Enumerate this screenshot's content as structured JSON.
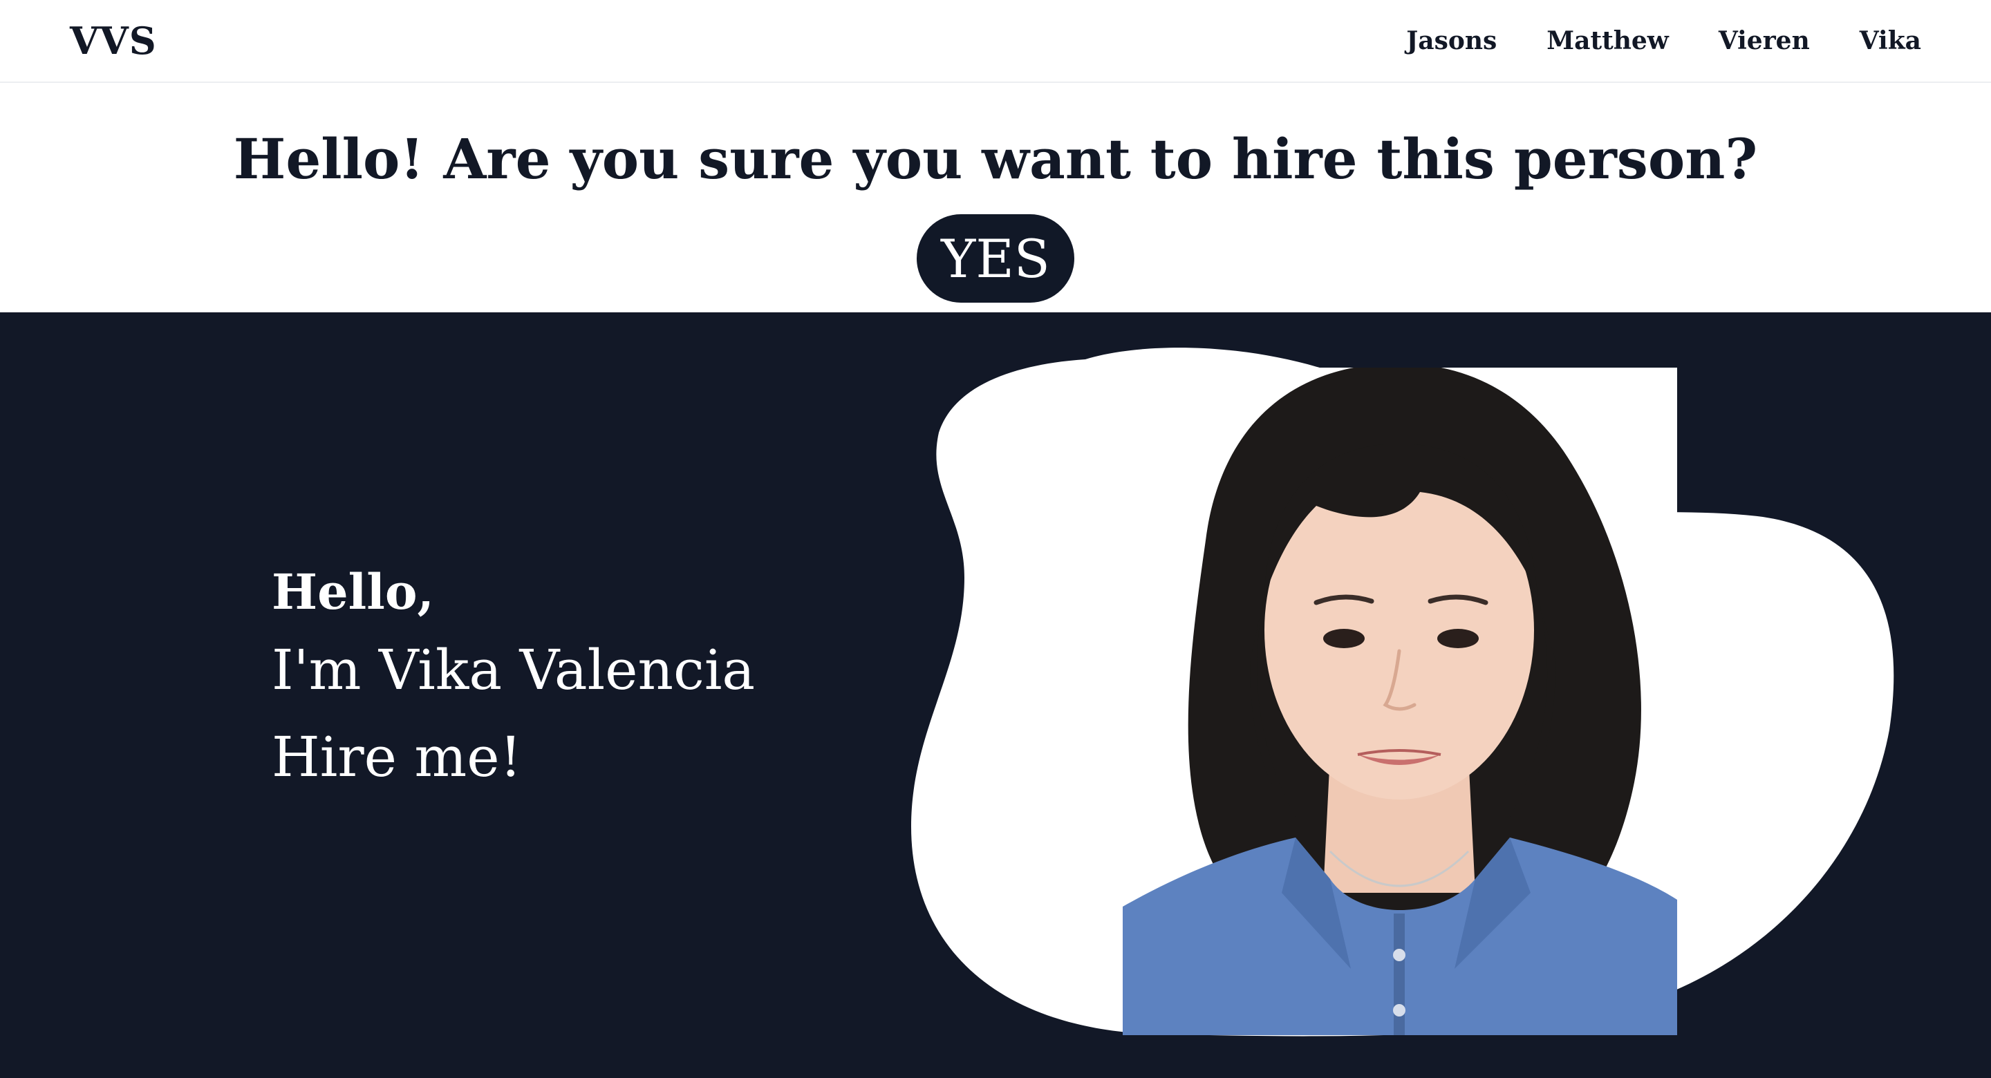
{
  "navbar": {
    "brand": "VVS",
    "links": [
      {
        "label": "Jasons"
      },
      {
        "label": "Matthew"
      },
      {
        "label": "Vieren"
      },
      {
        "label": "Vika"
      }
    ]
  },
  "confirm": {
    "question": "Hello! Are you sure you want to hire this person?",
    "yes_label": "YES"
  },
  "hero": {
    "greeting": "Hello,",
    "name_line": "I'm Vika Valencia",
    "cta_line": "Hire me!"
  },
  "colors": {
    "navy": "#121827",
    "text_dark": "#121826",
    "white": "#ffffff",
    "shirt_blue": "#5d82c0"
  },
  "icons": {
    "portrait": "profile-photo"
  }
}
